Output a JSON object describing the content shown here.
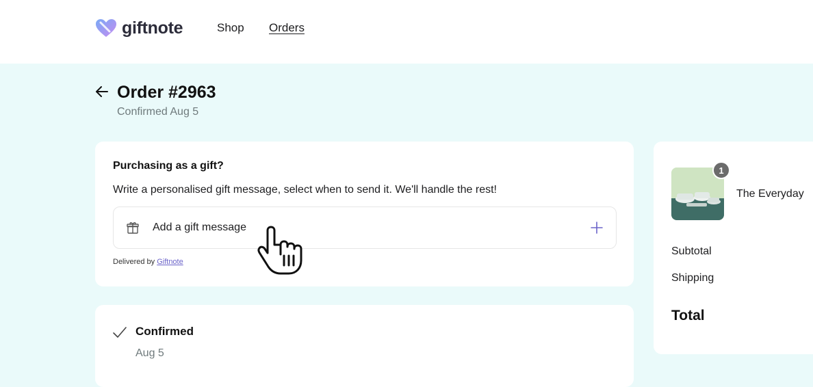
{
  "header": {
    "logo_text": "giftnote",
    "nav": {
      "shop": "Shop",
      "orders": "Orders"
    }
  },
  "order": {
    "title": "Order #2963",
    "subtitle": "Confirmed Aug 5"
  },
  "gift": {
    "heading": "Purchasing as a gift?",
    "description": "Write a personalised gift message, select when to send it. We'll handle the rest!",
    "field_label": "Add a gift message",
    "delivered_by_prefix": "Delivered by ",
    "delivered_by_link": "Giftnote"
  },
  "status": {
    "label": "Confirmed",
    "date": "Aug 5"
  },
  "summary": {
    "quantity": "1",
    "product_name": "The Everyday",
    "subtotal_label": "Subtotal",
    "shipping_label": "Shipping",
    "total_label": "Total"
  },
  "colors": {
    "page_background": "#eafafa",
    "accent": "#6b63c9",
    "logo_gradient_start": "#7aa9f5",
    "logo_gradient_end": "#c58cf0"
  },
  "icons": {
    "back": "arrow-left-icon",
    "gift": "gift-icon",
    "plus": "plus-icon",
    "check": "check-icon",
    "cursor": "hand-pointer-icon"
  }
}
